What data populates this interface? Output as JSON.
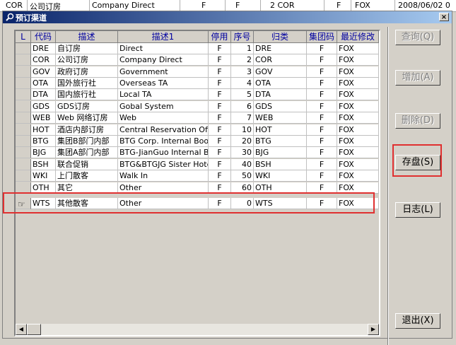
{
  "background_row": {
    "code": "COR",
    "desc": "公司订房",
    "desc1": "Company Direct",
    "f1": "F",
    "f2": "F",
    "seq_cat": "2 COR",
    "f3": "F",
    "user": "FOX",
    "date": "2008/06/02 0"
  },
  "window": {
    "title": "预订渠道",
    "close_label": "×"
  },
  "grid": {
    "columns": [
      "L",
      "代码",
      "描述",
      "描述1",
      "停用",
      "序号",
      "归类",
      "集团码",
      "最近修改"
    ],
    "rows": [
      {
        "code": "DRE",
        "desc": "自订房",
        "desc1": "Direct",
        "halt": "F",
        "seq": "1",
        "cat": "DRE",
        "grp": "F",
        "mod": "FOX"
      },
      {
        "code": "COR",
        "desc": "公司订房",
        "desc1": "Company Direct",
        "halt": "F",
        "seq": "2",
        "cat": "COR",
        "grp": "F",
        "mod": "FOX"
      },
      {
        "code": "GOV",
        "desc": "政府订房",
        "desc1": "Government",
        "halt": "F",
        "seq": "3",
        "cat": "GOV",
        "grp": "F",
        "mod": "FOX"
      },
      {
        "code": "OTA",
        "desc": "国外旅行社",
        "desc1": "Overseas TA",
        "halt": "F",
        "seq": "4",
        "cat": "OTA",
        "grp": "F",
        "mod": "FOX"
      },
      {
        "code": "DTA",
        "desc": "国内旅行社",
        "desc1": "Local TA",
        "halt": "F",
        "seq": "5",
        "cat": "DTA",
        "grp": "F",
        "mod": "FOX"
      },
      {
        "code": "GDS",
        "desc": "GDS订房",
        "desc1": "Gobal System",
        "halt": "F",
        "seq": "6",
        "cat": "GDS",
        "grp": "F",
        "mod": "FOX"
      },
      {
        "code": "WEB",
        "desc": "Web 网络订房",
        "desc1": "Web",
        "halt": "F",
        "seq": "7",
        "cat": "WEB",
        "grp": "F",
        "mod": "FOX"
      },
      {
        "code": "HOT",
        "desc": "酒店内部订房",
        "desc1": "Central Reservation Offic",
        "halt": "F",
        "seq": "10",
        "cat": "HOT",
        "grp": "F",
        "mod": "FOX"
      },
      {
        "code": "BTG",
        "desc": "集团B部门内部",
        "desc1": "BTG Corp. Internal Booki",
        "halt": "F",
        "seq": "20",
        "cat": "BTG",
        "grp": "F",
        "mod": "FOX"
      },
      {
        "code": "BJG",
        "desc": "集团A部门内部",
        "desc1": "BTG-JianGuo Internal Boo",
        "halt": "F",
        "seq": "30",
        "cat": "BJG",
        "grp": "F",
        "mod": "FOX"
      },
      {
        "code": "BSH",
        "desc": "联合促销",
        "desc1": "BTG&BTGJG Sister Hotels",
        "halt": "F",
        "seq": "40",
        "cat": "BSH",
        "grp": "F",
        "mod": "FOX"
      },
      {
        "code": "WKI",
        "desc": "上门散客",
        "desc1": "Walk In",
        "halt": "F",
        "seq": "50",
        "cat": "WKI",
        "grp": "F",
        "mod": "FOX"
      },
      {
        "code": "OTH",
        "desc": "其它",
        "desc1": "Other",
        "halt": "F",
        "seq": "60",
        "cat": "OTH",
        "grp": "F",
        "mod": "FOX"
      },
      {
        "code": "WTS",
        "desc": "其他散客",
        "desc1": "Other",
        "halt": "F",
        "seq": "0",
        "cat": "WTS",
        "grp": "F",
        "mod": "FOX"
      }
    ],
    "pointer": "☞"
  },
  "buttons": {
    "query": "查询(Q)",
    "add": "增加(A)",
    "delete": "删除(D)",
    "save": "存盘(S)",
    "log": "日志(L)",
    "exit": "退出(X)"
  },
  "scroll": {
    "left": "◀",
    "right": "▶"
  },
  "colors": {
    "highlight": "#e03030",
    "title_bar": "#0a246a"
  }
}
